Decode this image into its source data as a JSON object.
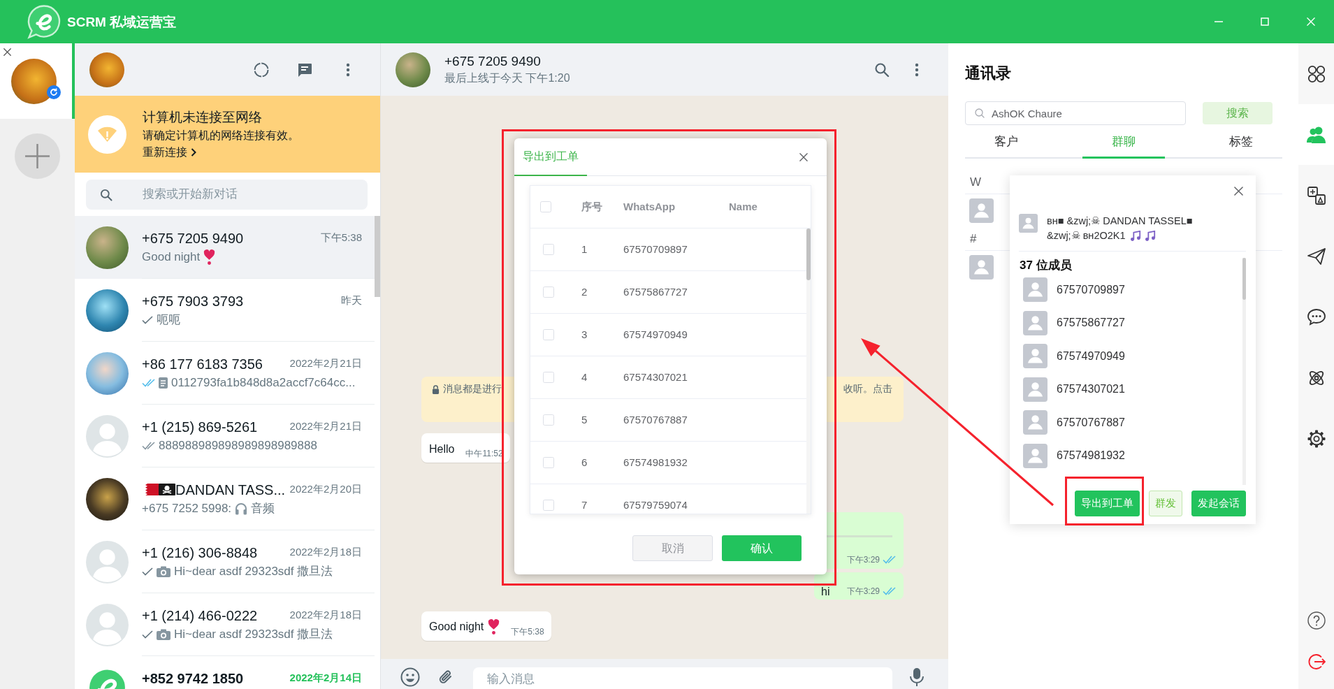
{
  "app": {
    "title": "SCRM 私域运营宝"
  },
  "accounts": [
    {
      "selected": true,
      "syncing": true
    }
  ],
  "chat_list": {
    "banner": {
      "title": "计算机未连接至网络",
      "message": "请确定计算机的网络连接有效。",
      "link": "重新连接"
    },
    "search": {
      "placeholder": "搜索或开始新对话"
    },
    "chats": [
      {
        "name": "+675 7205 9490",
        "time": "下午5:38",
        "preview": "Good night",
        "emoji": {
          "kind": "heart"
        },
        "avatar": {
          "kind": "photo"
        },
        "selected": true,
        "unread": false
      },
      {
        "name": "+675 7903 3793",
        "time": "昨天",
        "receipt": {
          "kind": "sent"
        },
        "preview": "呃呃",
        "avatar": {
          "kind": "photo"
        },
        "selected": false,
        "unread": false
      },
      {
        "name": "+86 177 6183 7356",
        "time": "2022年2月21日",
        "receipt": {
          "kind": "read"
        },
        "attachment": {
          "kind": "document"
        },
        "preview": "0112793fa1b848d8a2accf7c64cc...",
        "avatar": {
          "kind": "photo"
        },
        "selected": false,
        "unread": false
      },
      {
        "name": "+1 (215) 869-5261",
        "time": "2022年2月21日",
        "receipt": {
          "kind": "delivered"
        },
        "preview": "888988989898989898989888",
        "avatar": {
          "kind": "default"
        },
        "selected": false,
        "unread": false
      },
      {
        "name": "DANDAN TASS...",
        "name_emoji": [
          {
            "kind": "flag"
          },
          {
            "kind": "pirate_flag"
          }
        ],
        "time": "2022年2月20日",
        "sender": "+675 7252 5998:",
        "attachment": {
          "kind": "audio"
        },
        "preview": "音频",
        "avatar": {
          "kind": "photo"
        },
        "selected": false,
        "unread": false
      },
      {
        "name": "+1 (216) 306-8848",
        "time": "2022年2月18日",
        "receipt": {
          "kind": "sent"
        },
        "attachment": {
          "kind": "photo"
        },
        "preview": "Hi~dear asdf 29323sdf 撒旦法",
        "avatar": {
          "kind": "default"
        },
        "selected": false,
        "unread": false
      },
      {
        "name": "+1 (214) 466-0222",
        "time": "2022年2月18日",
        "receipt": {
          "kind": "sent"
        },
        "attachment": {
          "kind": "photo"
        },
        "preview": "Hi~dear asdf 29323sdf 撒旦法",
        "avatar": {
          "kind": "default"
        },
        "selected": false,
        "unread": false
      },
      {
        "name": "+852 9742 1850",
        "time": "2022年2月14日",
        "avatar": {
          "kind": "logo"
        },
        "selected": false,
        "unread": true
      }
    ]
  },
  "chat": {
    "contact": {
      "name": "+675 7205 9490",
      "status": "最后上线于今天 下午1:20"
    },
    "messages": [
      {
        "kind": "notice",
        "text_left": "消息都是进行",
        "text_right": "收听。点击"
      },
      {
        "kind": "incoming",
        "text": "Hello",
        "time": "中午11:52"
      },
      {
        "kind": "outgoing",
        "time": "下午3:29",
        "receipt": {
          "kind": "read"
        }
      },
      {
        "kind": "outgoing",
        "text": "hi",
        "time": "下午3:29",
        "receipt": {
          "kind": "read"
        }
      },
      {
        "kind": "incoming",
        "text": "Good night",
        "emoji": {
          "kind": "heart"
        },
        "time": "下午5:38"
      }
    ],
    "composer": {
      "placeholder": "输入消息"
    }
  },
  "export_dialog": {
    "highlighted": true,
    "tab": "导出到工单",
    "columns": [
      "序号",
      "WhatsApp",
      "Name"
    ],
    "select_all": false,
    "rows": [
      {
        "index": "1",
        "whatsapp": "67570709897",
        "checked": false
      },
      {
        "index": "2",
        "whatsapp": "67575867727",
        "checked": false
      },
      {
        "index": "3",
        "whatsapp": "67574970949",
        "checked": false
      },
      {
        "index": "4",
        "whatsapp": "67574307021",
        "checked": false
      },
      {
        "index": "5",
        "whatsapp": "67570767887",
        "checked": false
      },
      {
        "index": "6",
        "whatsapp": "67574981932",
        "checked": false
      },
      {
        "index": "7",
        "whatsapp": "67579759074",
        "checked": false
      }
    ],
    "cancel": "取消",
    "confirm": "确认"
  },
  "contacts": {
    "title": "通讯录",
    "search": {
      "value": "AshOK Chaure"
    },
    "search_button": "搜索",
    "tabs": [
      {
        "label": "客户",
        "selected": false
      },
      {
        "label": "群聊",
        "selected": true
      },
      {
        "label": "标签",
        "selected": false
      }
    ],
    "sections": [
      {
        "letter": "W",
        "contacts": [
          {
            "avatar": {
              "kind": "default"
            }
          }
        ]
      },
      {
        "letter": "#",
        "contacts": [
          {
            "avatar": {
              "kind": "default"
            }
          }
        ]
      }
    ]
  },
  "group_card": {
    "name_lines": [
      "ʙʜ■ &zwj;☠ DANDAN TASSEL■",
      "&zwj;☠ ʙʜ2O2K1"
    ],
    "name_emoji": [
      {
        "kind": "music"
      },
      {
        "kind": "music"
      }
    ],
    "member_count": "37 位成员",
    "members": [
      "67570709897",
      "67575867727",
      "67574970949",
      "67574307021",
      "67570767887",
      "67574981932"
    ],
    "actions": [
      {
        "label": "导出到工单",
        "kind": "primary",
        "highlighted": true
      },
      {
        "label": "群发",
        "kind": "plain",
        "highlighted": false
      },
      {
        "label": "发起会话",
        "kind": "primary",
        "highlighted": false
      }
    ]
  },
  "rail": {
    "items": [
      {
        "kind": "apps",
        "selected": false
      },
      {
        "kind": "contacts",
        "selected": true
      },
      {
        "kind": "translate",
        "selected": false
      },
      {
        "kind": "send",
        "selected": false
      },
      {
        "kind": "chat",
        "selected": false
      },
      {
        "kind": "atom",
        "selected": false
      },
      {
        "kind": "settings",
        "selected": false
      }
    ],
    "footer": [
      {
        "kind": "help"
      },
      {
        "kind": "logout"
      }
    ]
  },
  "annotations": {
    "arrow": true
  }
}
